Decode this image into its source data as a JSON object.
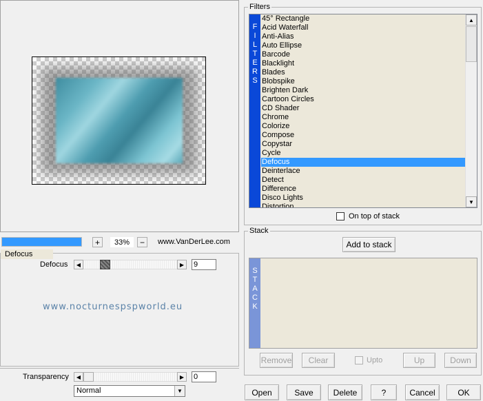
{
  "preview": {
    "zoom_label": "33%",
    "progress_percent": 100,
    "site": "www.VanDerLee.com"
  },
  "params": {
    "group_title": "Defocus",
    "defocus": {
      "label": "Defocus",
      "value": "9"
    },
    "watermark": "www.nocturnespspworld.eu",
    "transparency": {
      "label": "Transparency",
      "value": "0"
    },
    "blend_mode": "Normal"
  },
  "filters": {
    "title": "Filters",
    "side_label": [
      "F",
      "I",
      "L",
      "T",
      "E",
      "R",
      "S"
    ],
    "items": [
      "45° Rectangle",
      "Acid Waterfall",
      "Anti-Alias",
      "Auto Ellipse",
      "Barcode",
      "Blacklight",
      "Blades",
      "Blobspike",
      "Brighten Dark",
      "Cartoon Circles",
      "CD Shader",
      "Chrome",
      "Colorize",
      "Compose",
      "Copystar",
      "Cycle",
      "Defocus",
      "Deinterlace",
      "Detect",
      "Difference",
      "Disco Lights",
      "Distortion"
    ],
    "selected": "Defocus",
    "on_top_label": "On top of stack"
  },
  "stack": {
    "title": "Stack",
    "add_label": "Add to stack",
    "side_label": [
      "S",
      "T",
      "A",
      "C",
      "K"
    ],
    "remove_label": "Remove",
    "clear_label": "Clear",
    "upto_label": "Upto",
    "up_label": "Up",
    "down_label": "Down"
  },
  "bottom": {
    "open": "Open",
    "save": "Save",
    "delete": "Delete",
    "help": "?",
    "cancel": "Cancel",
    "ok": "OK"
  },
  "colors": {
    "selection": "#3399ff",
    "filters_band": "#0a48d8",
    "stack_band": "#7a95d8",
    "list_bg": "#ece8da"
  }
}
